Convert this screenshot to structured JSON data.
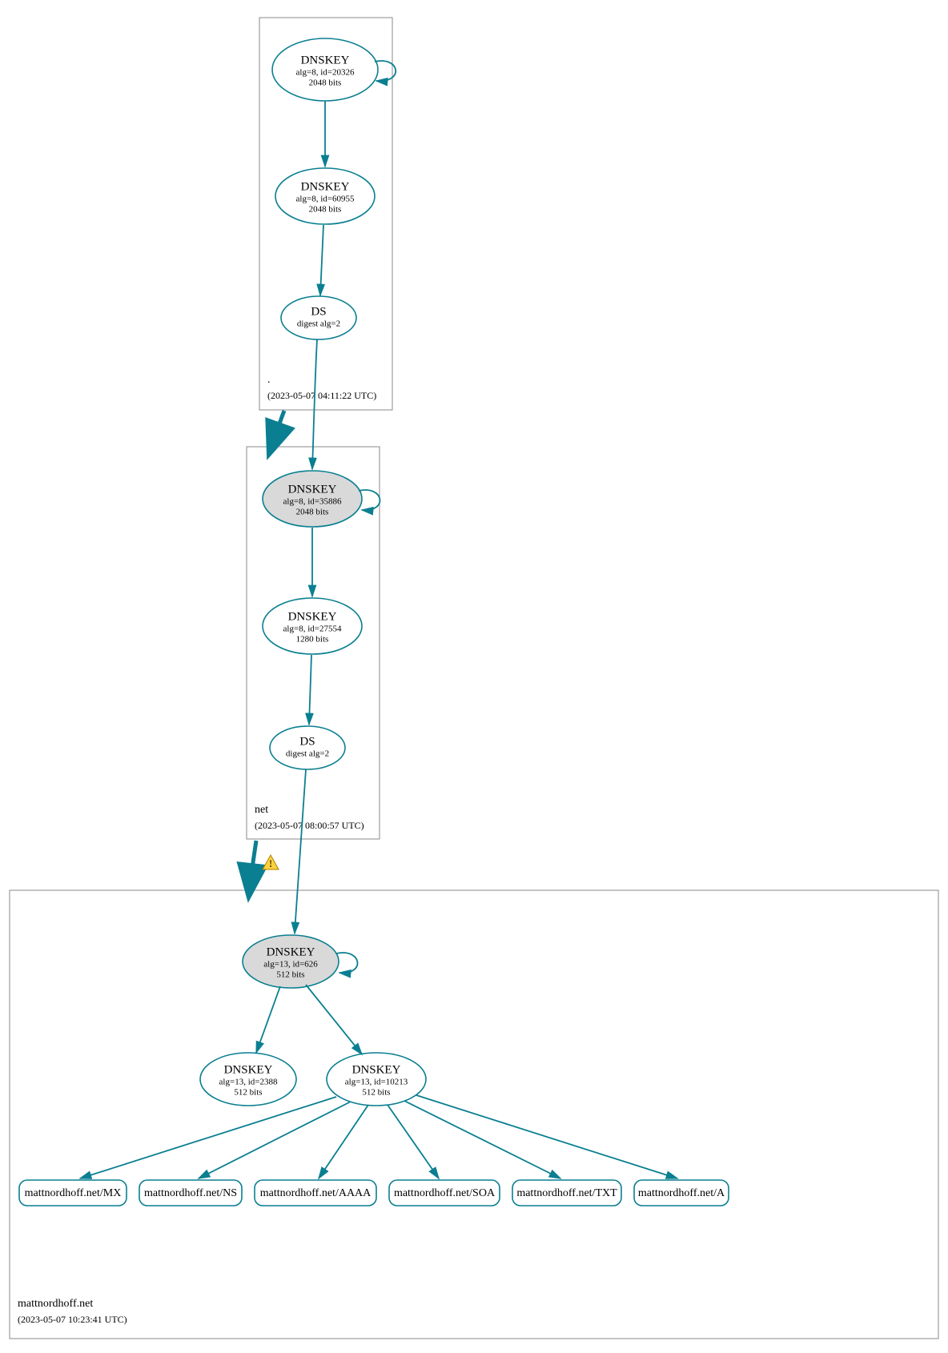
{
  "zones": {
    "root": {
      "name": ".",
      "ts": "(2023-05-07 04:11:22 UTC)"
    },
    "net": {
      "name": "net",
      "ts": "(2023-05-07 08:00:57 UTC)"
    },
    "domain": {
      "name": "mattnordhoff.net",
      "ts": "(2023-05-07 10:23:41 UTC)"
    }
  },
  "nodes": {
    "root_ksk": {
      "title": "DNSKEY",
      "line2": "alg=8, id=20326",
      "line3": "2048 bits"
    },
    "root_zsk": {
      "title": "DNSKEY",
      "line2": "alg=8, id=60955",
      "line3": "2048 bits"
    },
    "root_ds": {
      "title": "DS",
      "line2": "digest alg=2",
      "line3": ""
    },
    "net_ksk": {
      "title": "DNSKEY",
      "line2": "alg=8, id=35886",
      "line3": "2048 bits"
    },
    "net_zsk": {
      "title": "DNSKEY",
      "line2": "alg=8, id=27554",
      "line3": "1280 bits"
    },
    "net_ds": {
      "title": "DS",
      "line2": "digest alg=2",
      "line3": ""
    },
    "dom_ksk": {
      "title": "DNSKEY",
      "line2": "alg=13, id=626",
      "line3": "512 bits"
    },
    "dom_zsk1": {
      "title": "DNSKEY",
      "line2": "alg=13, id=2388",
      "line3": "512 bits"
    },
    "dom_zsk2": {
      "title": "DNSKEY",
      "line2": "alg=13, id=10213",
      "line3": "512 bits"
    }
  },
  "records": {
    "mx": "mattnordhoff.net/MX",
    "ns": "mattnordhoff.net/NS",
    "aaaa": "mattnordhoff.net/AAAA",
    "soa": "mattnordhoff.net/SOA",
    "txt": "mattnordhoff.net/TXT",
    "a": "mattnordhoff.net/A"
  }
}
